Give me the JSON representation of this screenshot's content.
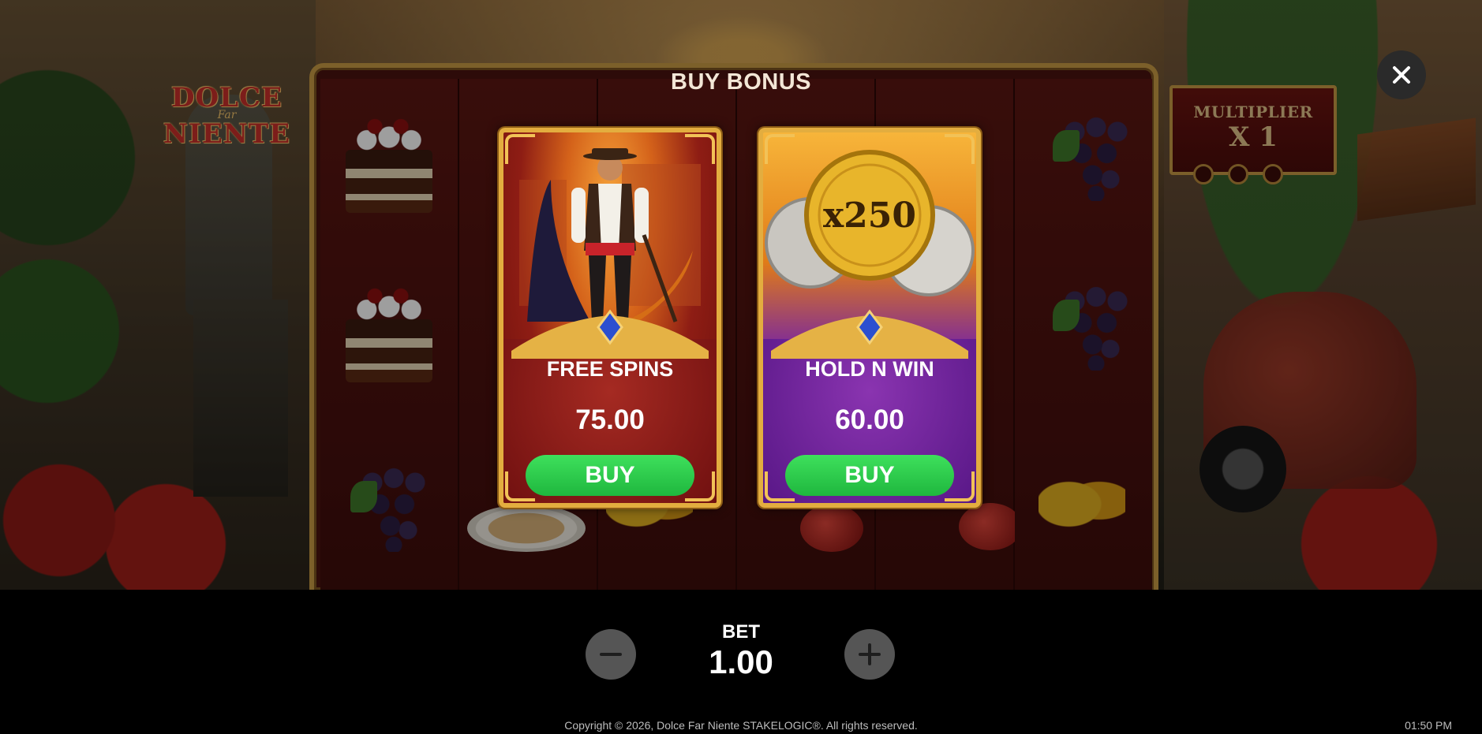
{
  "game": {
    "logo": {
      "line1": "DOLCE",
      "line2": "Far",
      "line3": "NIENTE"
    },
    "multiplier": {
      "label": "MULTIPLIER",
      "value": "X 1"
    }
  },
  "overlay": {
    "title": "BUY BONUS",
    "close_icon": "close-icon",
    "cards": [
      {
        "name": "FREE SPINS",
        "price": "75.00",
        "buy_label": "BUY"
      },
      {
        "name": "HOLD N WIN",
        "price": "60.00",
        "buy_label": "BUY",
        "coin_text": "x250"
      }
    ]
  },
  "controls": {
    "bet_label": "BET",
    "bet_value": "1.00",
    "decrease_icon": "minus-icon",
    "increase_icon": "plus-icon"
  },
  "footer": {
    "copyright": "Copyright © 2026, Dolce Far Niente STAKELOGIC®. All rights reserved.",
    "time": "01:50 PM"
  },
  "colors": {
    "buy_button": "#2ecc4f",
    "frame_gold": "#c89b45",
    "free_spins_card": "#8e1d14",
    "hold_n_win_card": "#5a1783"
  }
}
